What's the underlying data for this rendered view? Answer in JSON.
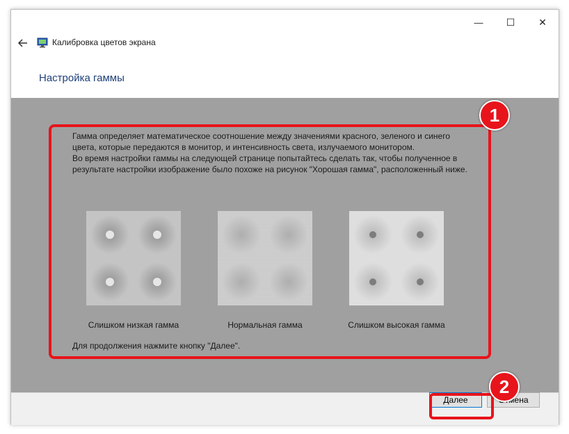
{
  "window": {
    "controls": {
      "minimize": "—",
      "maximize": "☐",
      "close": "✕"
    },
    "title": "Калибровка цветов экрана",
    "app_icon": "monitor-icon",
    "back_icon": "back-arrow-icon"
  },
  "page": {
    "heading": "Настройка гаммы",
    "description": [
      "Гамма определяет математическое соотношение между значениями красного, зеленого и синего цвета, которые передаются в монитор, и интенсивность света, излучаемого монитором.",
      "Во время настройки гаммы на следующей странице попытайтесь сделать так, чтобы полученное в результате настройки изображение было похоже на рисунок \"Хорошая гамма\", расположенный ниже."
    ],
    "samples": [
      {
        "label": "Слишком низкая гамма",
        "dot": "light"
      },
      {
        "label": "Нормальная гамма",
        "dot": "none"
      },
      {
        "label": "Слишком высокая гамма",
        "dot": "dark"
      }
    ],
    "continue_hint": "Для продолжения нажмите кнопку \"Далее\"."
  },
  "footer": {
    "next_label": "Далее",
    "cancel_label": "Отмена"
  },
  "annotations": {
    "badge_1": "1",
    "badge_2": "2",
    "highlight_color": "#e8141b"
  },
  "colors": {
    "panel_bg": "#a0a0a0",
    "heading": "#1e3f7a",
    "footer_bg": "#f0f0f0"
  }
}
